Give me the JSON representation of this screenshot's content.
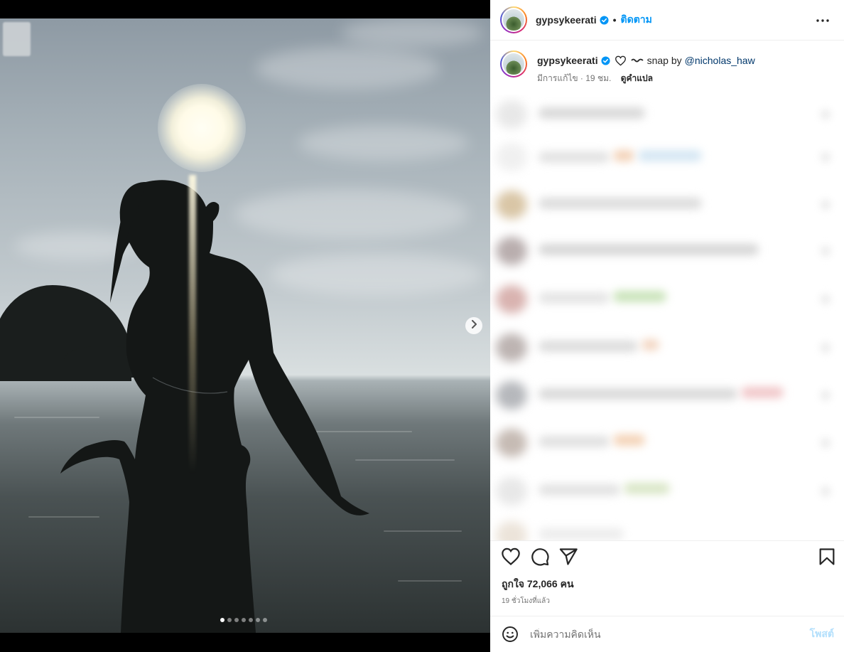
{
  "post": {
    "username": "gypsykeerati",
    "follow_label": "ติดตาม",
    "separator": "•",
    "more_icon": "more-horizontal-icon",
    "verified_icon": "verified-badge-icon"
  },
  "caption": {
    "username": "gypsykeerati",
    "body": "snap by",
    "mention": "@nicholas_haw",
    "edited": "มีการแก้ไข · 19 ชม.",
    "translate": "ดูคำแปล"
  },
  "media": {
    "carousel_count": 7,
    "active_index": 0,
    "next_icon": "chevron-right-icon"
  },
  "actions": {
    "like_icon": "heart-icon",
    "comment_icon": "comment-icon",
    "share_icon": "send-icon",
    "save_icon": "bookmark-icon",
    "likes_text": "ถูกใจ 72,066 คน",
    "time_ago": "19 ชั่วโมงที่แล้ว"
  },
  "comment_box": {
    "placeholder": "เพิ่มความคิดเห็น",
    "post_label": "โพสต์",
    "emoji_icon": "emoji-icon"
  },
  "colors": {
    "accent": "#0095f6",
    "post_disabled": "#b2dffc",
    "mention": "#00376b"
  }
}
